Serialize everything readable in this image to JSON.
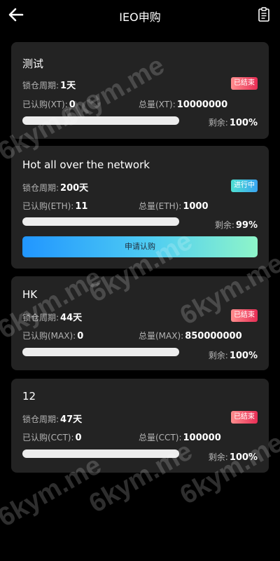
{
  "header": {
    "title": "IEO申购",
    "back_icon": "arrow-left-icon",
    "record_icon": "clipboard-icon"
  },
  "cards": [
    {
      "name": "测试",
      "lock_label": "锁仓周期:",
      "lock_value": "1天",
      "status": "已结束",
      "status_type": "ended",
      "subscribed_label": "已认购(XT):",
      "subscribed_value": "0",
      "total_label": "总量(XT):",
      "total_value": "10000000",
      "remain_label": "剩余:",
      "remain_value": "100%",
      "progress": 0
    },
    {
      "name": "Hot all over the network",
      "lock_label": "锁仓周期:",
      "lock_value": "200天",
      "status": "进行中",
      "status_type": "active",
      "subscribed_label": "已认购(ETH):",
      "subscribed_value": "11",
      "total_label": "总量(ETH):",
      "total_value": "1000",
      "remain_label": "剩余:",
      "remain_value": "99%",
      "progress": 0.01,
      "button": "申请认购"
    },
    {
      "name": "HK",
      "lock_label": "锁仓周期:",
      "lock_value": "44天",
      "status": "已结束",
      "status_type": "ended",
      "subscribed_label": "已认购(MAX):",
      "subscribed_value": "0",
      "total_label": "总量(MAX):",
      "total_value": "850000000",
      "remain_label": "剩余:",
      "remain_value": "100%",
      "progress": 0
    },
    {
      "name": "12",
      "lock_label": "锁仓周期:",
      "lock_value": "47天",
      "status": "已结束",
      "status_type": "ended",
      "subscribed_label": "已认购(CCT):",
      "subscribed_value": "0",
      "total_label": "总量(CCT):",
      "total_value": "100000",
      "remain_label": "剩余:",
      "remain_value": "100%",
      "progress": 0
    }
  ],
  "watermark": "6kym.me"
}
